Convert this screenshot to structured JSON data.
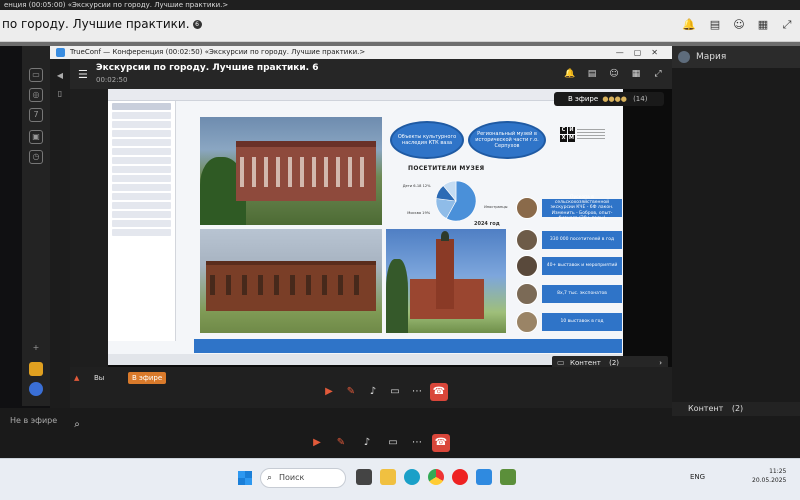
{
  "outer_window": {
    "titlebar_text": "енция (00:05:00) «Экскурсии по городу. Лучшие практики.>",
    "header_title": "по городу. Лучшие практики.",
    "header_dot": "6",
    "user_name": "Мария",
    "not_in_air": "Не в эфире",
    "content_chip": "Контент (2)"
  },
  "inner_window": {
    "titlebar_text": "TrueConf — Конференция (00:02:50) «Экскурсии по городу. Лучшие практики.>",
    "conference_title": "Экскурсии по городу. Лучшие практики.",
    "conference_dot": "6",
    "elapsed_time": "00:02:50",
    "live_badge": "В эфире",
    "live_count": "(14)",
    "content_chip": "Контент",
    "content_count": "(2)",
    "self_label": "Вы",
    "self_status": "В эфире"
  },
  "slide": {
    "bubble_objects": "Объекты культурного наследия КТК ваза",
    "bubble_museum": "Региональный музей в исторической части г.о. Серпухов",
    "logo_letters": [
      "С",
      "И",
      "Х",
      "М"
    ],
    "visitors_title": "ПОСЕТИТЕЛИ МУЗЕЯ",
    "year_label": "2024 год",
    "stats": [
      "Пускопа в сельскохозяйственной экскурсии КЧЕ - 6Ф лакон. Изменить - Бобров, опыт-бизнеса (20+ годы)",
      "330 000 посетителей в год",
      "40+ выставок и мероприятий",
      "8x,7 тыс. экспонатов",
      "10 выставок в год"
    ]
  },
  "chart_data": {
    "type": "pie",
    "title": "ПОСЕТИТЕЛИ МУЗЕЯ",
    "subtitle": "2024 год",
    "slices": [
      {
        "label": "Иностранцы",
        "value": 58
      },
      {
        "label": "Москва",
        "value": 19
      },
      {
        "label": "Дети 6-18",
        "value": 12
      },
      {
        "label": "Прочие",
        "value": 11
      }
    ]
  },
  "taskbar": {
    "search_placeholder": "Поиск",
    "lang": "ENG",
    "time": "11:25",
    "date": "20.05.2025"
  },
  "colors": {
    "slide_accent": "#2f74c8",
    "end_call": "#d9463a",
    "live_orange": "#d97a2b"
  }
}
